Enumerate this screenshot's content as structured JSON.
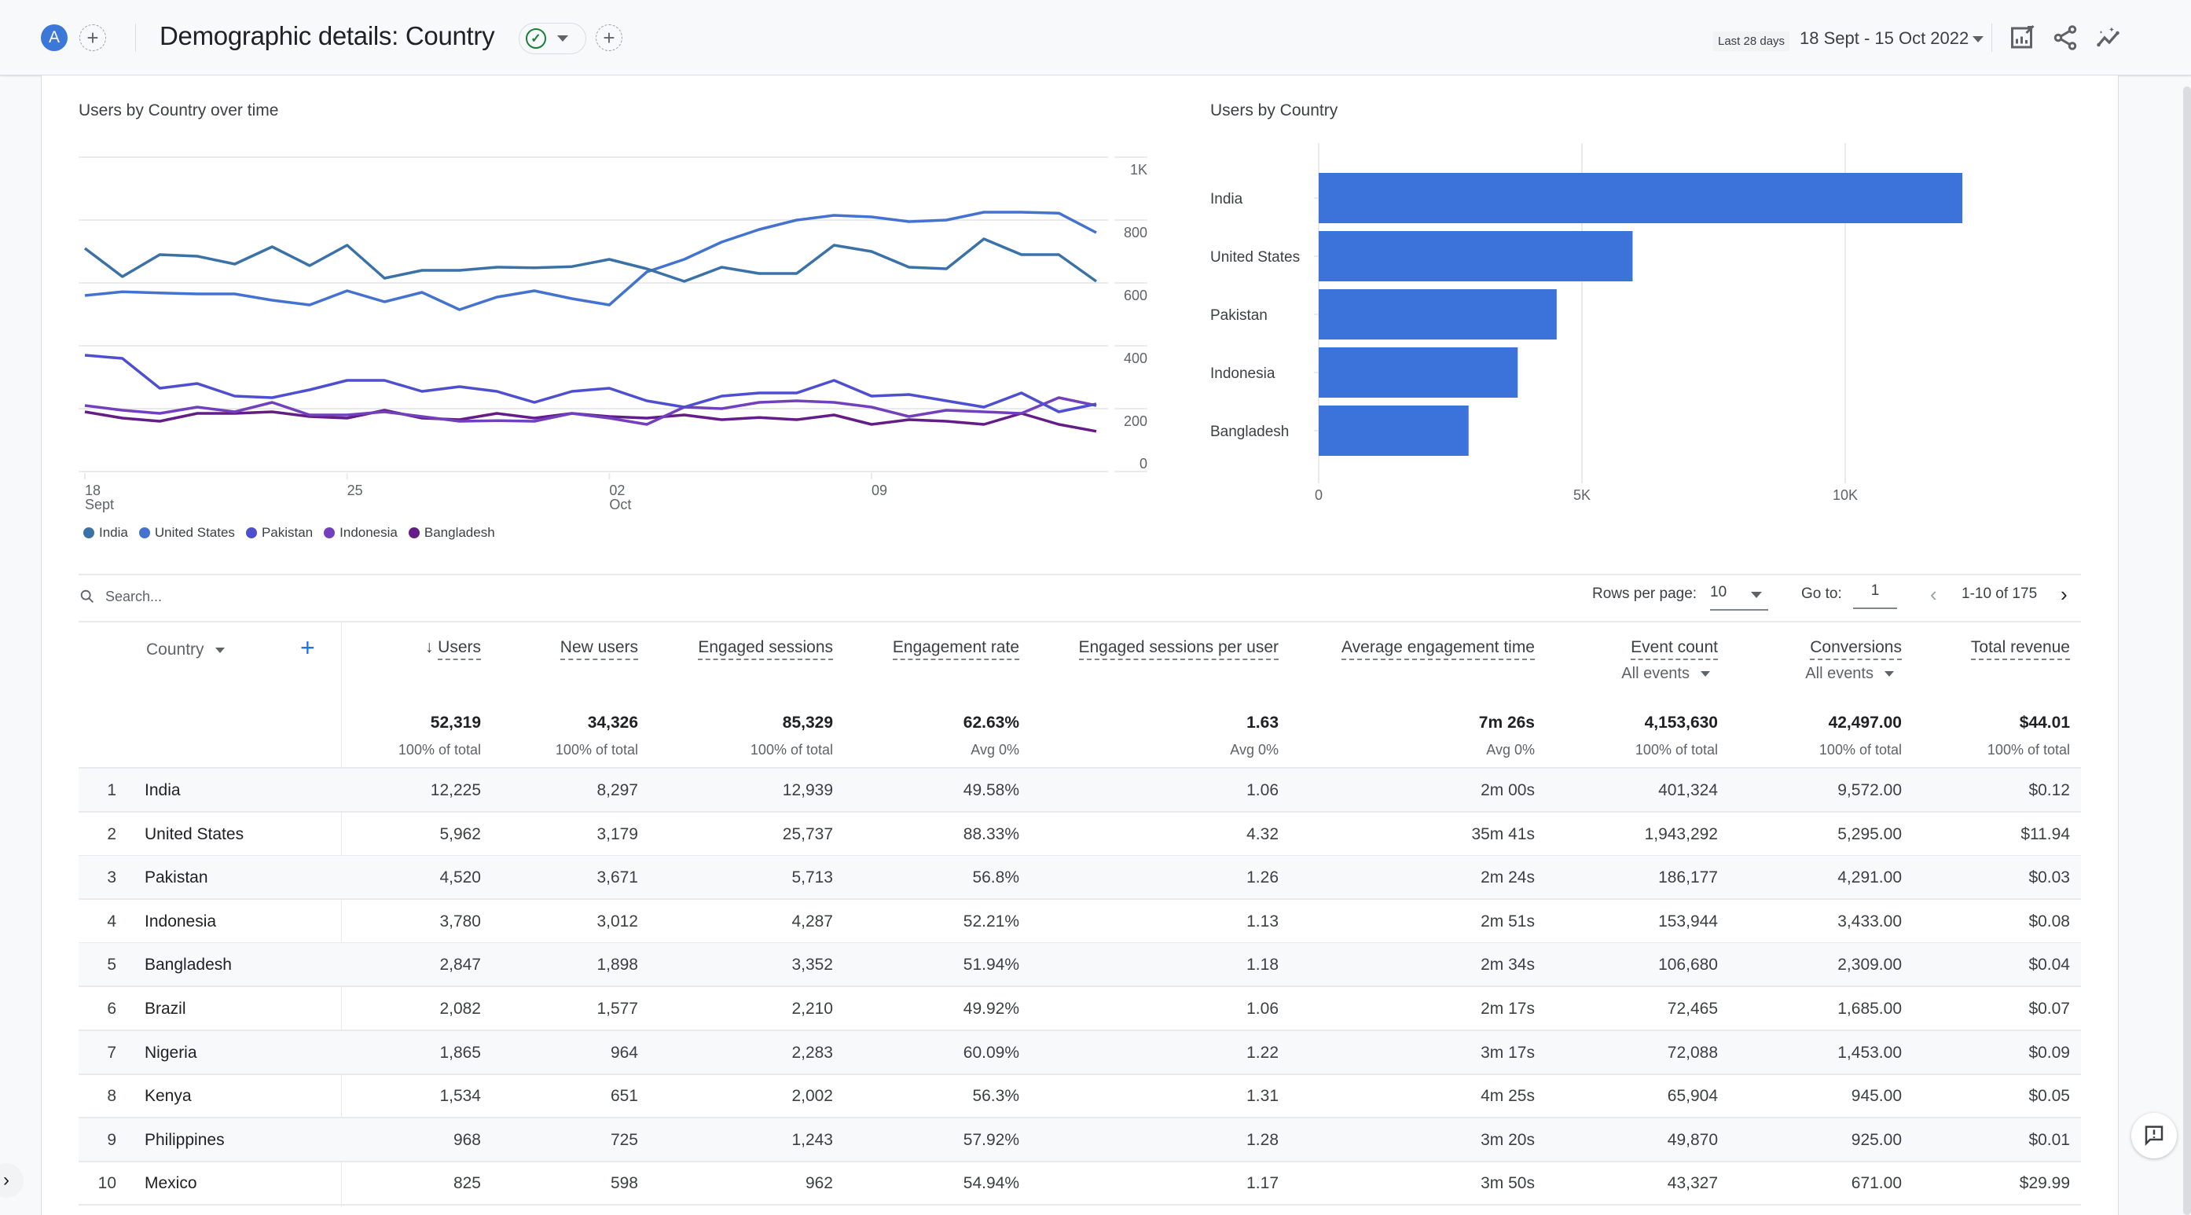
{
  "header": {
    "avatar_letter": "A",
    "add_comparison": "+",
    "title": "Demographic details: Country",
    "add_card": "+",
    "date_chip": "Last 28 days",
    "date_range": "18 Sept - 15 Oct 2022",
    "icons": [
      "customize-report-icon",
      "share-icon",
      "insights-icon"
    ]
  },
  "chart_data": [
    {
      "type": "line",
      "title": "Users by Country over time",
      "xlabel": "",
      "ylabel": "",
      "ylim": [
        0,
        1000
      ],
      "yticks": [
        "0",
        "200",
        "400",
        "600",
        "800",
        "1K"
      ],
      "xticks": [
        {
          "day": "18",
          "month": "Sept",
          "index": 0
        },
        {
          "day": "25",
          "month": "",
          "index": 7
        },
        {
          "day": "02",
          "month": "Oct",
          "index": 14
        },
        {
          "day": "09",
          "month": "",
          "index": 21
        }
      ],
      "grid": true,
      "legend": "bottom-left",
      "x": [
        "18 Sept",
        "19 Sept",
        "20 Sept",
        "21 Sept",
        "22 Sept",
        "23 Sept",
        "24 Sept",
        "25 Sept",
        "26 Sept",
        "27 Sept",
        "28 Sept",
        "29 Sept",
        "30 Sept",
        "01 Oct",
        "02 Oct",
        "03 Oct",
        "04 Oct",
        "05 Oct",
        "06 Oct",
        "07 Oct",
        "08 Oct",
        "09 Oct",
        "10 Oct",
        "11 Oct",
        "12 Oct",
        "13 Oct",
        "14 Oct",
        "15 Oct"
      ],
      "series": [
        {
          "name": "India",
          "color": "#3a72a8",
          "values": [
            710,
            620,
            690,
            685,
            660,
            715,
            655,
            720,
            615,
            640,
            640,
            650,
            648,
            652,
            675,
            645,
            605,
            650,
            630,
            630,
            720,
            700,
            650,
            645,
            740,
            690,
            690,
            605
          ]
        },
        {
          "name": "United States",
          "color": "#4372d0",
          "values": [
            560,
            572,
            568,
            565,
            565,
            545,
            530,
            575,
            540,
            570,
            515,
            555,
            575,
            550,
            530,
            635,
            675,
            730,
            770,
            800,
            815,
            810,
            795,
            800,
            825,
            825,
            822,
            760
          ]
        },
        {
          "name": "Pakistan",
          "color": "#4e4fd0",
          "values": [
            370,
            360,
            265,
            280,
            240,
            235,
            260,
            290,
            290,
            255,
            270,
            255,
            220,
            255,
            265,
            225,
            205,
            240,
            250,
            250,
            290,
            240,
            245,
            225,
            205,
            250,
            190,
            215
          ]
        },
        {
          "name": "Indonesia",
          "color": "#7340bd",
          "values": [
            210,
            195,
            185,
            205,
            190,
            220,
            180,
            180,
            190,
            175,
            160,
            162,
            160,
            185,
            170,
            150,
            205,
            200,
            220,
            225,
            220,
            205,
            175,
            195,
            190,
            185,
            235,
            210
          ]
        },
        {
          "name": "Bangladesh",
          "color": "#641c86",
          "values": [
            190,
            170,
            160,
            185,
            185,
            190,
            175,
            170,
            195,
            170,
            165,
            185,
            170,
            185,
            175,
            170,
            180,
            165,
            172,
            165,
            180,
            150,
            165,
            160,
            150,
            185,
            150,
            128
          ]
        }
      ]
    },
    {
      "type": "bar",
      "orientation": "horizontal",
      "title": "Users by Country",
      "categories": [
        "India",
        "United States",
        "Pakistan",
        "Indonesia",
        "Bangladesh"
      ],
      "values": [
        12225,
        5962,
        4520,
        3780,
        2847
      ],
      "color": "#3b73da",
      "xlim": [
        0,
        15000
      ],
      "xticks": [
        "0",
        "5K",
        "10K"
      ],
      "grid": true
    }
  ],
  "table": {
    "search_placeholder": "Search...",
    "rows_per_page_label": "Rows per page:",
    "rows_per_page_value": "10",
    "goto_label": "Go to:",
    "goto_value": "1",
    "page_range": "1-10 of 175",
    "dimension_label": "Country",
    "add_dimension": "+",
    "columns": [
      {
        "label": "Users",
        "sorted": true,
        "total": "52,319",
        "total_sub": "100% of total"
      },
      {
        "label": "New users",
        "total": "34,326",
        "total_sub": "100% of total"
      },
      {
        "label": "Engaged sessions",
        "total": "85,329",
        "total_sub": "100% of total"
      },
      {
        "label": "Engagement rate",
        "total": "62.63%",
        "total_sub": "Avg 0%"
      },
      {
        "label": "Engaged sessions per user",
        "total": "1.63",
        "total_sub": "Avg 0%"
      },
      {
        "label": "Average engagement time",
        "total": "7m 26s",
        "total_sub": "Avg 0%"
      },
      {
        "label": "Event count",
        "sub_select": "All events",
        "total": "4,153,630",
        "total_sub": "100% of total"
      },
      {
        "label": "Conversions",
        "sub_select": "All events",
        "total": "42,497.00",
        "total_sub": "100% of total"
      },
      {
        "label": "Total revenue",
        "total": "$44.01",
        "total_sub": "100% of total"
      }
    ],
    "rows": [
      {
        "idx": "1",
        "country": "India",
        "cells": [
          "12,225",
          "8,297",
          "12,939",
          "49.58%",
          "1.06",
          "2m 00s",
          "401,324",
          "9,572.00",
          "$0.12"
        ]
      },
      {
        "idx": "2",
        "country": "United States",
        "cells": [
          "5,962",
          "3,179",
          "25,737",
          "88.33%",
          "4.32",
          "35m 41s",
          "1,943,292",
          "5,295.00",
          "$11.94"
        ]
      },
      {
        "idx": "3",
        "country": "Pakistan",
        "cells": [
          "4,520",
          "3,671",
          "5,713",
          "56.8%",
          "1.26",
          "2m 24s",
          "186,177",
          "4,291.00",
          "$0.03"
        ]
      },
      {
        "idx": "4",
        "country": "Indonesia",
        "cells": [
          "3,780",
          "3,012",
          "4,287",
          "52.21%",
          "1.13",
          "2m 51s",
          "153,944",
          "3,433.00",
          "$0.08"
        ]
      },
      {
        "idx": "5",
        "country": "Bangladesh",
        "cells": [
          "2,847",
          "1,898",
          "3,352",
          "51.94%",
          "1.18",
          "2m 34s",
          "106,680",
          "2,309.00",
          "$0.04"
        ]
      },
      {
        "idx": "6",
        "country": "Brazil",
        "cells": [
          "2,082",
          "1,577",
          "2,210",
          "49.92%",
          "1.06",
          "2m 17s",
          "72,465",
          "1,685.00",
          "$0.07"
        ]
      },
      {
        "idx": "7",
        "country": "Nigeria",
        "cells": [
          "1,865",
          "964",
          "2,283",
          "60.09%",
          "1.22",
          "3m 17s",
          "72,088",
          "1,453.00",
          "$0.09"
        ]
      },
      {
        "idx": "8",
        "country": "Kenya",
        "cells": [
          "1,534",
          "651",
          "2,002",
          "56.3%",
          "1.31",
          "4m 25s",
          "65,904",
          "945.00",
          "$0.05"
        ]
      },
      {
        "idx": "9",
        "country": "Philippines",
        "cells": [
          "968",
          "725",
          "1,243",
          "57.92%",
          "1.28",
          "3m 20s",
          "49,870",
          "925.00",
          "$0.01"
        ]
      },
      {
        "idx": "10",
        "country": "Mexico",
        "cells": [
          "825",
          "598",
          "962",
          "54.94%",
          "1.17",
          "3m 50s",
          "43,327",
          "671.00",
          "$29.99"
        ]
      }
    ]
  },
  "side_toggle": "›"
}
